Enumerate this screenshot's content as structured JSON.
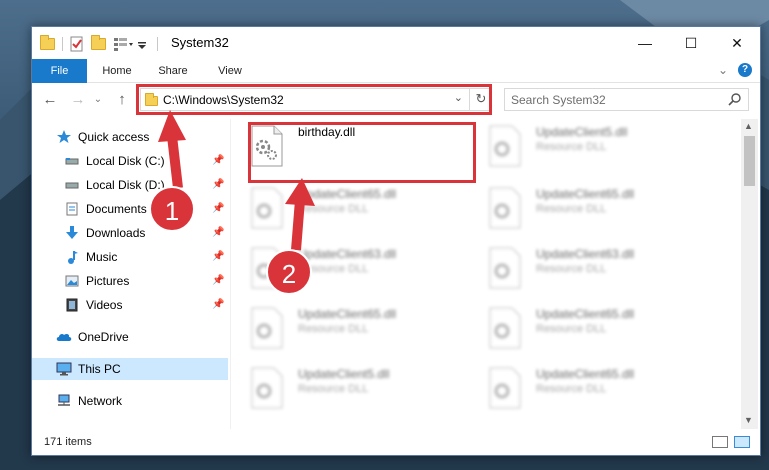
{
  "window": {
    "title": "System32",
    "caption": {
      "minimize": "—",
      "maximize": "☐",
      "close": "✕"
    }
  },
  "ribbon": {
    "tabs": [
      "File",
      "Home",
      "Share",
      "View"
    ],
    "expand": "⌄",
    "help": "?"
  },
  "nav": {
    "back": "←",
    "forward": "→",
    "recent": "⌄",
    "up": "↑",
    "address": "C:\\Windows\\System32",
    "address_dropdown": "⌄",
    "refresh": "↻",
    "search_placeholder": "Search System32"
  },
  "sidebar": {
    "items": [
      {
        "label": "Quick access",
        "icon": "star-icon",
        "pinned": false,
        "selected": false
      },
      {
        "label": "Local Disk (C:)",
        "icon": "drive-icon",
        "pinned": true,
        "selected": false
      },
      {
        "label": "Local Disk (D:)",
        "icon": "drive-icon",
        "pinned": true,
        "selected": false
      },
      {
        "label": "Documents",
        "icon": "documents-icon",
        "pinned": true,
        "selected": false
      },
      {
        "label": "Downloads",
        "icon": "download-icon",
        "pinned": true,
        "selected": false
      },
      {
        "label": "Music",
        "icon": "music-icon",
        "pinned": true,
        "selected": false
      },
      {
        "label": "Pictures",
        "icon": "pictures-icon",
        "pinned": true,
        "selected": false
      },
      {
        "label": "Videos",
        "icon": "videos-icon",
        "pinned": true,
        "selected": false
      },
      {
        "label": "OneDrive",
        "icon": "cloud-icon",
        "pinned": false,
        "selected": false
      },
      {
        "label": "This PC",
        "icon": "computer-icon",
        "pinned": false,
        "selected": true
      },
      {
        "label": "Network",
        "icon": "network-icon",
        "pinned": false,
        "selected": false
      }
    ]
  },
  "files": [
    {
      "name": "birthday.dll",
      "type": "",
      "blurred": false
    },
    {
      "name": "UpdateClient5.dll",
      "type": "Resource DLL",
      "blurred": true
    },
    {
      "name": "UpdateClient5.dll",
      "type": "Resource DLL",
      "blurred": true
    },
    {
      "name": "UpdateClient65.dll",
      "type": "Resource DLL",
      "blurred": true
    },
    {
      "name": "UpdateClient63.dll",
      "type": "Resource DLL",
      "blurred": true
    },
    {
      "name": "UpdateClient63.dll",
      "type": "Resource DLL",
      "blurred": true
    },
    {
      "name": "UpdateClient65.dll",
      "type": "Resource DLL",
      "blurred": true
    },
    {
      "name": "UpdateClient65.dll",
      "type": "Resource DLL",
      "blurred": true
    },
    {
      "name": "UpdateClient5.dll",
      "type": "Resource DLL",
      "blurred": true
    },
    {
      "name": "UpdateClient65.dll",
      "type": "Resource DLL",
      "blurred": true
    }
  ],
  "status": {
    "count": "171 items"
  },
  "annotations": {
    "step1": "1",
    "step2": "2"
  },
  "colors": {
    "accent": "#1979ca",
    "annotation": "#d9343a",
    "selected": "#cce8ff"
  }
}
